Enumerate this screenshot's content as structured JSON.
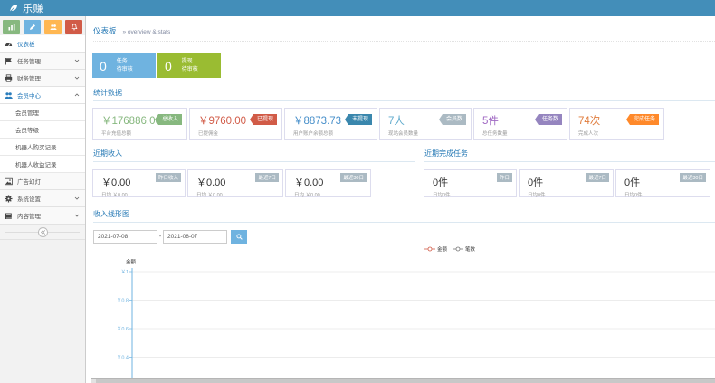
{
  "app": {
    "title": "乐赚"
  },
  "colors": {
    "navbar": "#438eb9",
    "accent": "#2679b5"
  },
  "shortcuts": [
    {
      "icon": "chart-icon",
      "color": "#87b87f"
    },
    {
      "icon": "pencil-icon",
      "color": "#6fb3e0"
    },
    {
      "icon": "users-icon",
      "color": "#ffb752"
    },
    {
      "icon": "bell-icon",
      "color": "#d15b47"
    }
  ],
  "sidebar": {
    "dashboard": "仪表板",
    "task_mgmt": "任务管理",
    "finance_mgmt": "财务管理",
    "member_center": "会员中心",
    "member_sub": [
      "会员管理",
      "会员等级",
      "机器人购买记录",
      "机器人收益记录"
    ],
    "ads": "广告幻灯",
    "settings": "系统设置",
    "content_mgmt": "内容管理"
  },
  "header": {
    "title": "仪表板",
    "subtitle": "» overview & stats"
  },
  "tasks": [
    {
      "count": "0",
      "line1": "任务",
      "line2": "待审核",
      "color": "#6fb3e0"
    },
    {
      "count": "0",
      "line1": "提现",
      "line2": "待审核",
      "color": "#9abc32"
    }
  ],
  "stats_title": "统计数据",
  "stats": [
    {
      "value": "￥176886.00",
      "desc": "平台充值总额",
      "badge": "总收入",
      "badge_color": "#87b87f",
      "value_color": "#87b87f"
    },
    {
      "value": "￥9760.00",
      "desc": "已提佣金",
      "badge": "已提现",
      "badge_color": "#d15b47",
      "value_color": "#d15b47"
    },
    {
      "value": "￥8873.73",
      "desc": "用户账户余额总额",
      "badge": "未提现",
      "badge_color": "#478fca",
      "value_color": "#478fca"
    },
    {
      "value": "7人",
      "desc": "现站会员数量",
      "badge": "会员数",
      "badge_color": "#abbac3",
      "value_color": "#5faacc"
    },
    {
      "value": "5件",
      "desc": "总任务数量",
      "badge": "任务数",
      "badge_color": "#9585bf",
      "value_color": "#a069c3"
    },
    {
      "value": "74次",
      "desc": "完成人次",
      "badge": "完成任务",
      "badge_color": "#ff892a",
      "value_color": "#e07b3b"
    }
  ],
  "recent_income": {
    "title": "近期收入",
    "items": [
      {
        "value": "￥0.00",
        "desc": "日均 ￥0.00",
        "tag": "昨日收入"
      },
      {
        "value": "￥0.00",
        "desc": "日均 ￥0.00",
        "tag": "最近7日"
      },
      {
        "value": "￥0.00",
        "desc": "日均 ￥0.00",
        "tag": "最近30日"
      }
    ]
  },
  "recent_tasks": {
    "title": "近期完成任务",
    "items": [
      {
        "value": "0件",
        "desc": "日均0件",
        "tag": "昨日"
      },
      {
        "value": "0件",
        "desc": "日均0件",
        "tag": "最近7日"
      },
      {
        "value": "0件",
        "desc": "日均0件",
        "tag": "最近30日"
      }
    ]
  },
  "income_chart": {
    "title": "收入线形图",
    "start_date": "2021-07-08",
    "end_date": "2021-08-07",
    "date_sep": "-"
  },
  "chart_data": {
    "type": "line",
    "ylabel": "金额",
    "y_ticks": [
      "￥1",
      "￥0.8",
      "￥0.6",
      "￥0.4"
    ],
    "series": [
      {
        "name": "金额",
        "color": "#d15b47",
        "values": []
      },
      {
        "name": "笔数",
        "color": "#777777",
        "values": []
      }
    ]
  }
}
